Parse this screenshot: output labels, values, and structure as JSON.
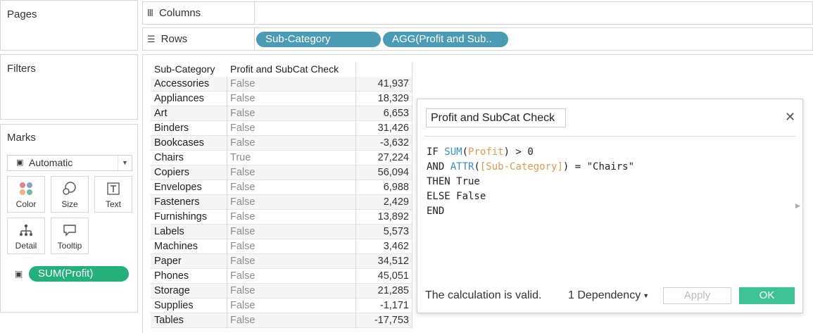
{
  "cards": {
    "pages": "Pages",
    "filters": "Filters",
    "marks": "Marks"
  },
  "shelves": {
    "columns_label": "Columns",
    "rows_label": "Rows",
    "rows_pills": [
      "Sub-Category",
      "AGG(Profit and Sub.."
    ]
  },
  "marks": {
    "type": "Automatic",
    "buttons": [
      "Color",
      "Size",
      "Text",
      "Detail",
      "Tooltip"
    ],
    "field_pill": "SUM(Profit)"
  },
  "table": {
    "headers": [
      "Sub-Category",
      "Profit and SubCat Check",
      ""
    ],
    "rows": [
      [
        "Accessories",
        "False",
        "41,937"
      ],
      [
        "Appliances",
        "False",
        "18,329"
      ],
      [
        "Art",
        "False",
        "6,653"
      ],
      [
        "Binders",
        "False",
        "31,426"
      ],
      [
        "Bookcases",
        "False",
        "-3,632"
      ],
      [
        "Chairs",
        "True",
        "27,224"
      ],
      [
        "Copiers",
        "False",
        "56,094"
      ],
      [
        "Envelopes",
        "False",
        "6,988"
      ],
      [
        "Fasteners",
        "False",
        "2,429"
      ],
      [
        "Furnishings",
        "False",
        "13,892"
      ],
      [
        "Labels",
        "False",
        "5,573"
      ],
      [
        "Machines",
        "False",
        "3,462"
      ],
      [
        "Paper",
        "False",
        "34,512"
      ],
      [
        "Phones",
        "False",
        "45,051"
      ],
      [
        "Storage",
        "False",
        "21,285"
      ],
      [
        "Supplies",
        "False",
        "-1,171"
      ],
      [
        "Tables",
        "False",
        "-17,753"
      ]
    ]
  },
  "dialog": {
    "calc_name": "Profit and SubCat Check",
    "code": {
      "l1_kw": "IF ",
      "l1_fn": "SUM",
      "l1_a": "(",
      "l1_field": "Profit",
      "l1_b": ") > 0",
      "l2_kw": "AND ",
      "l2_fn": "ATTR",
      "l2_a": "(",
      "l2_field": "[Sub-Category]",
      "l2_b": ") = \"Chairs\"",
      "l3": "THEN True",
      "l4": "ELSE False",
      "l5": "END"
    },
    "status": "The calculation is valid.",
    "dependency": "1 Dependency",
    "apply_label": "Apply",
    "ok_label": "OK"
  },
  "colors": {
    "row_pill": "#4a9bb4",
    "measure_pill": "#23b07a",
    "ok_button": "#3ec396",
    "function_text": "#3a8fc5",
    "field_text": "#e39a50"
  }
}
